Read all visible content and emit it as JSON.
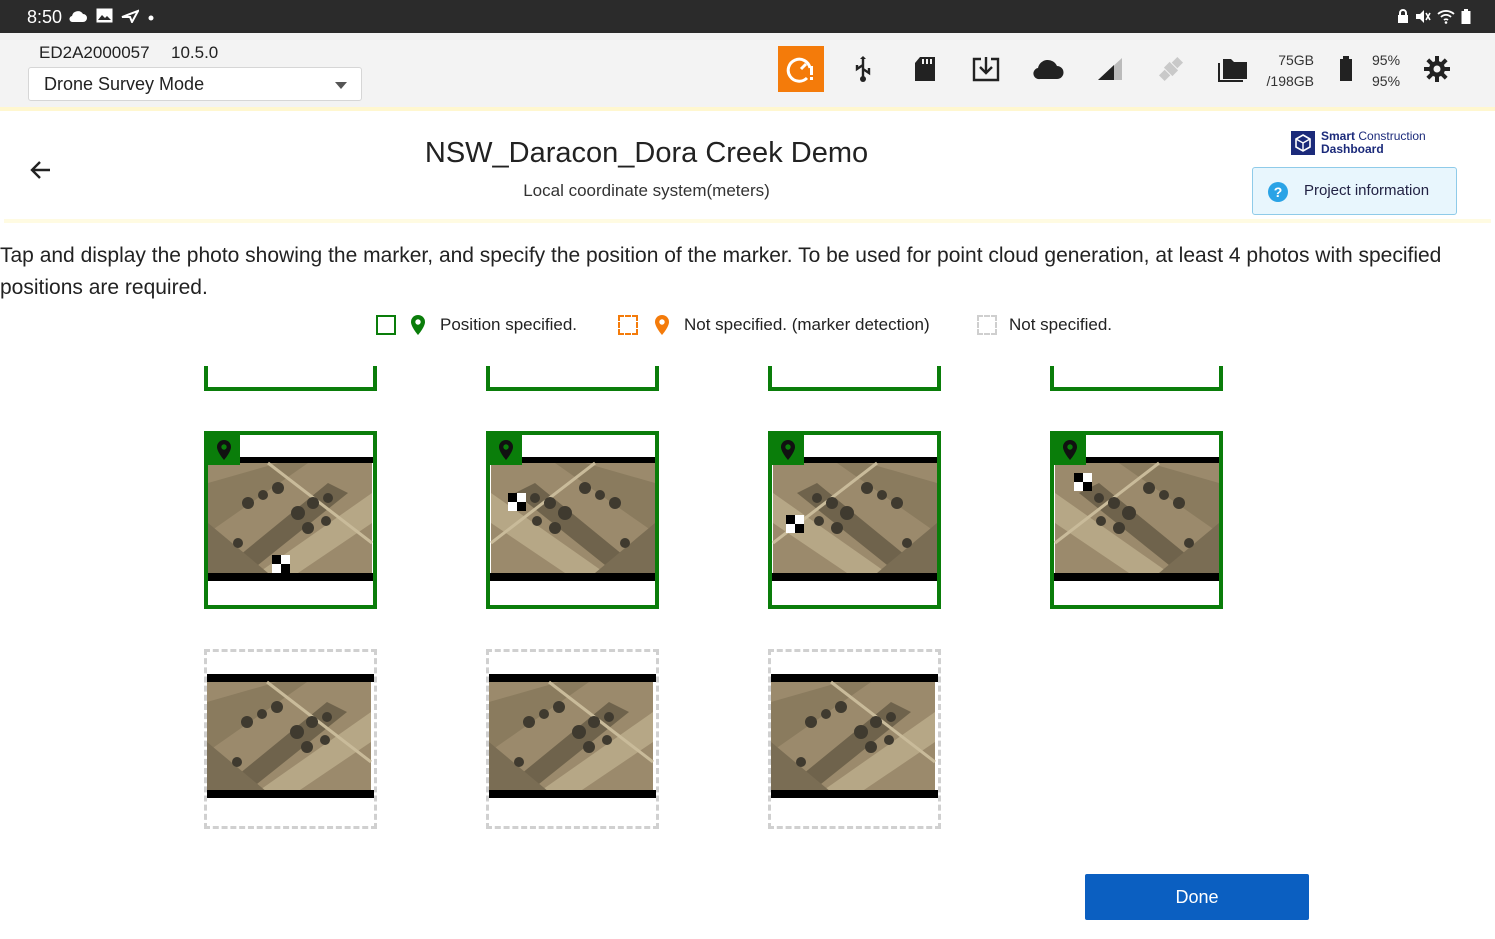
{
  "status_bar": {
    "time": "8:50",
    "left_icons": [
      "cloud-icon",
      "image-icon",
      "airplane-icon",
      "dot-icon"
    ],
    "right_icons": [
      "lock-icon",
      "mute-icon",
      "wifi-icon",
      "battery-icon"
    ]
  },
  "toolbar": {
    "device_id": "ED2A2000057",
    "version": "10.5.0",
    "mode": "Drone Survey Mode",
    "icons": [
      "gauge-alert-icon",
      "usb-icon",
      "sd-card-icon",
      "download-icon",
      "cloud-icon",
      "signal-icon",
      "satellite-icon",
      "folder-icon",
      "battery-icon",
      "gear-icon"
    ],
    "storage_used": "75GB",
    "storage_total": "/198GB",
    "battery_1": "95%",
    "battery_2": "95%",
    "alert_color": "#f47b0a"
  },
  "header": {
    "project_title": "NSW_Daracon_Dora Creek Demo",
    "coordinate_system": "Local coordinate system(meters)",
    "logo_line1_bold": "Smart",
    "logo_line1_rest": " Construction",
    "logo_line2": "Dashboard",
    "project_info_label": "Project information",
    "project_info_icon": "?"
  },
  "instruction": "Tap and display the photo showing the marker, and specify the position of the marker. To be used for point cloud generation, at least 4 photos with specified positions are required.",
  "legend": {
    "specified": "Position specified.",
    "marker_detection": "Not specified. (marker detection)",
    "not_specified": "Not specified."
  },
  "colors": {
    "specified": "#0a7d0a",
    "marker_detection": "#f47b0a",
    "not_specified": "#d0d0d0",
    "primary": "#0b5fc1"
  },
  "photos": {
    "row_partial": [
      {
        "status": "specified"
      },
      {
        "status": "specified"
      },
      {
        "status": "specified"
      },
      {
        "status": "specified"
      }
    ],
    "row_specified": [
      {
        "status": "specified",
        "has_marker": true
      },
      {
        "status": "specified",
        "has_marker": true
      },
      {
        "status": "specified",
        "has_marker": true
      },
      {
        "status": "specified",
        "has_marker": true
      }
    ],
    "row_unspecified": [
      {
        "status": "not_specified"
      },
      {
        "status": "not_specified"
      },
      {
        "status": "not_specified"
      }
    ]
  },
  "done_label": "Done"
}
